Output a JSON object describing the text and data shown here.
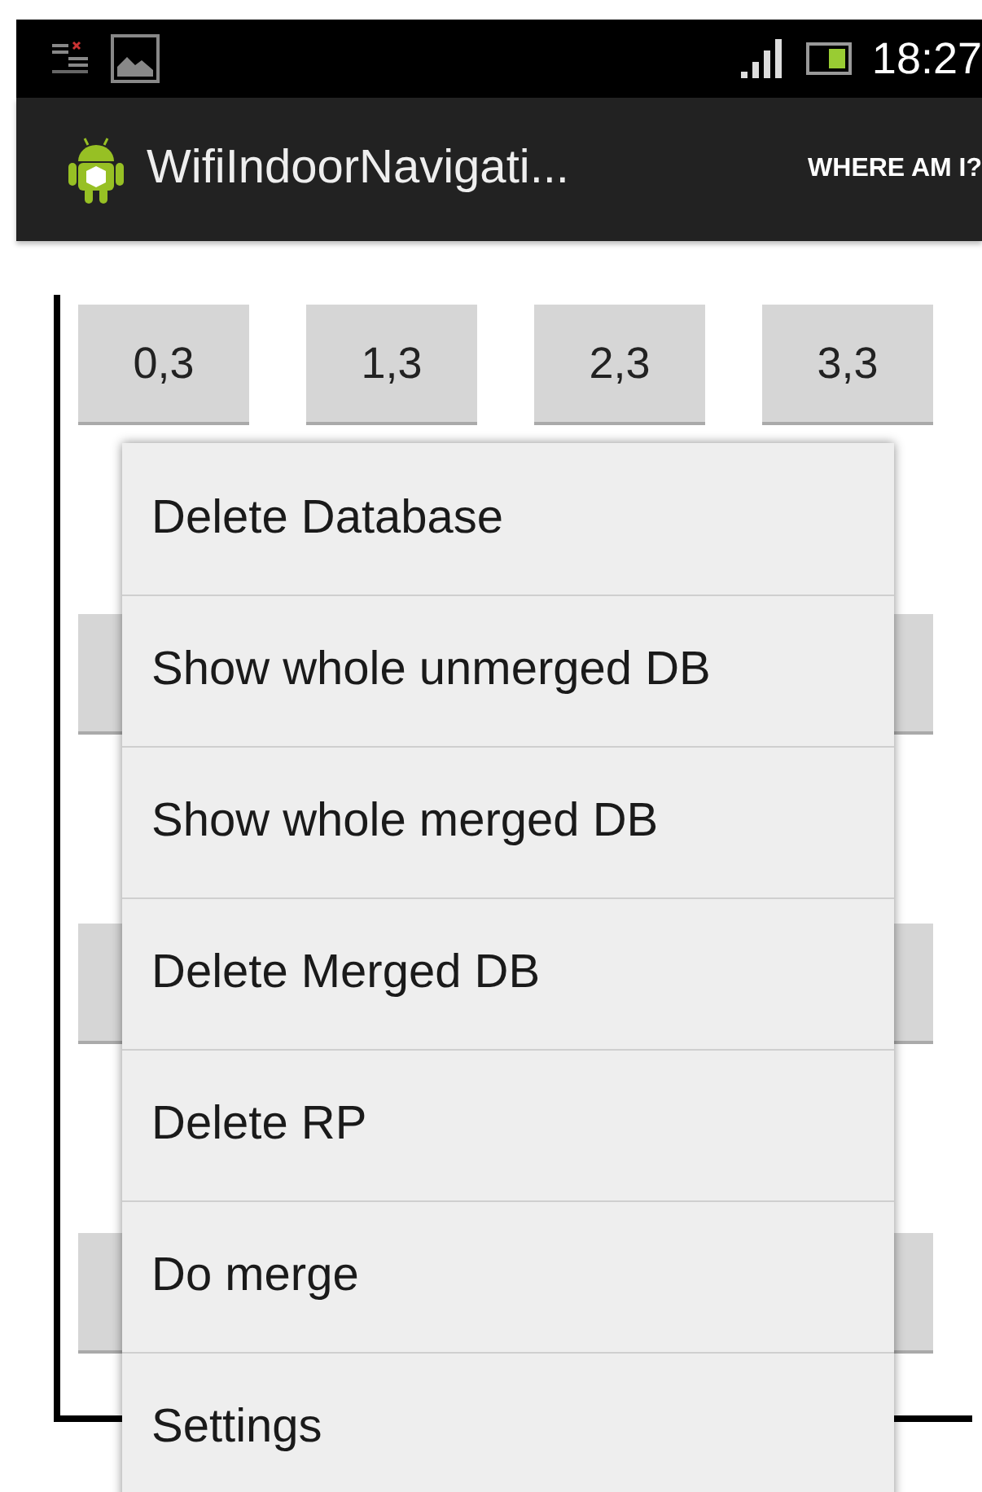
{
  "status_bar": {
    "time": "18:27"
  },
  "action_bar": {
    "title": "WifiIndoorNavigati...",
    "action": "WHERE AM I?"
  },
  "grid": {
    "top_row": [
      "0,3",
      "1,3",
      "2,3",
      "3,3"
    ]
  },
  "menu": {
    "items": [
      {
        "label": "Delete Database"
      },
      {
        "label": "Show whole unmerged DB"
      },
      {
        "label": "Show whole merged DB"
      },
      {
        "label": "Delete Merged DB"
      },
      {
        "label": "Delete RP"
      },
      {
        "label": "Do merge"
      },
      {
        "label": "Settings"
      }
    ]
  }
}
